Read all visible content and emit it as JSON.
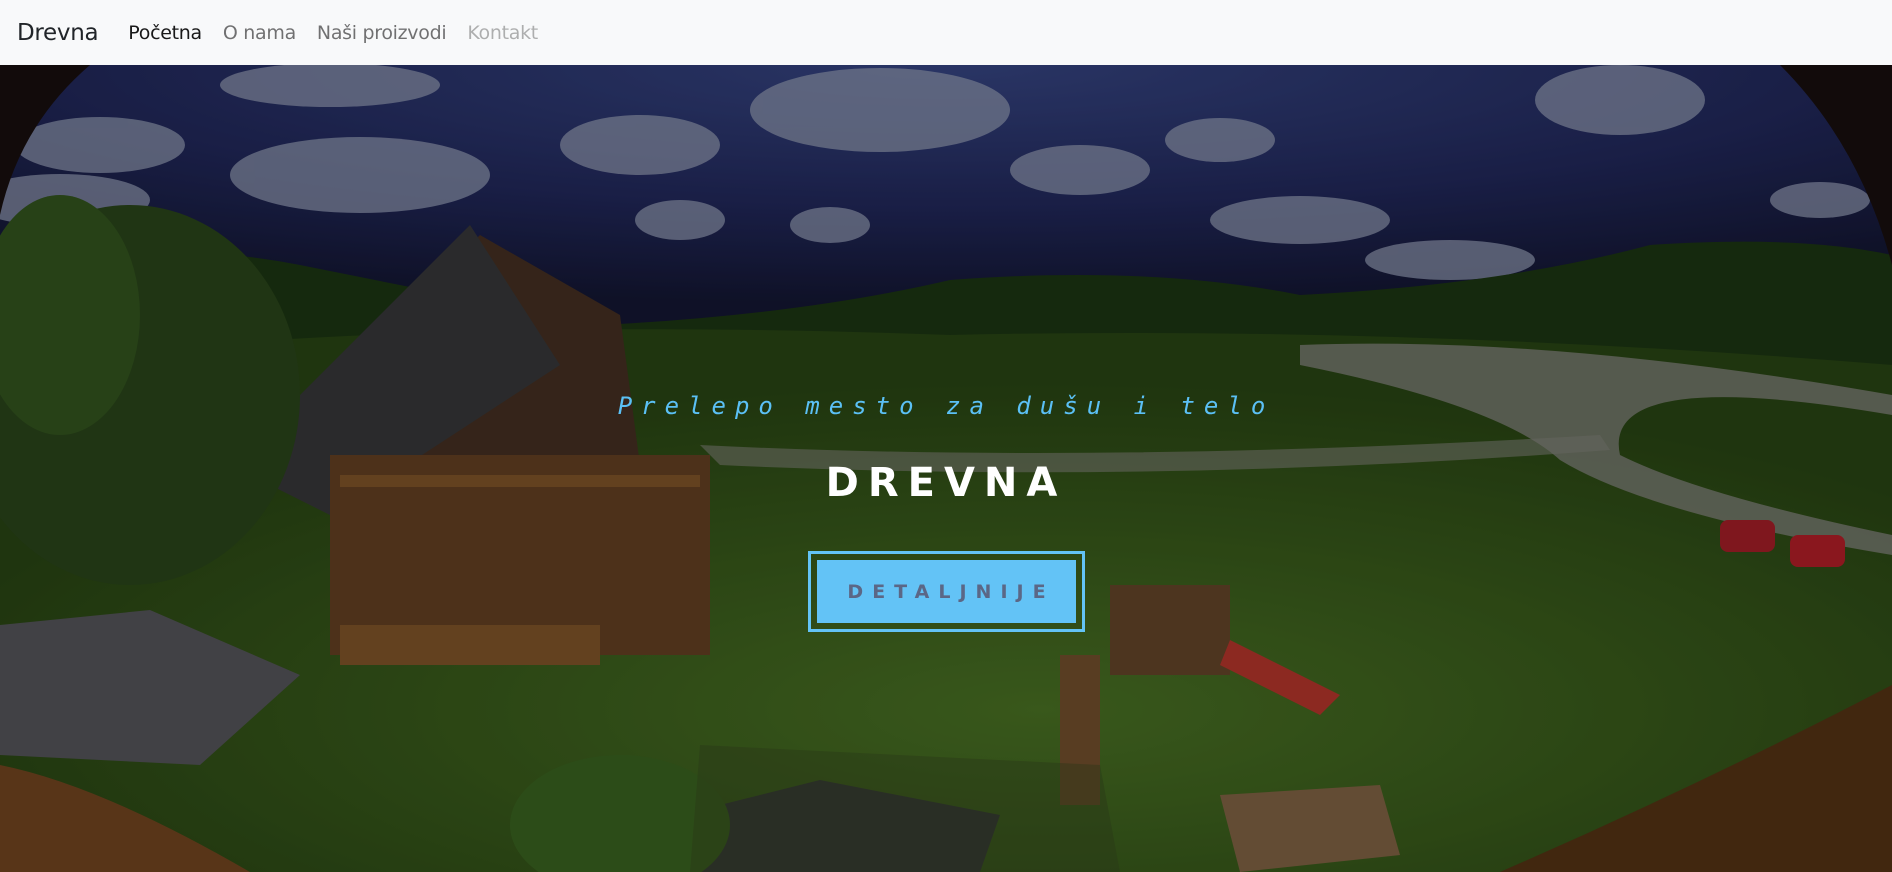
{
  "navbar": {
    "brand": "Drevna",
    "links": [
      {
        "label": "Početna",
        "state": "active"
      },
      {
        "label": "O nama",
        "state": "default"
      },
      {
        "label": "Naši proizvodi",
        "state": "default"
      },
      {
        "label": "Kontakt",
        "state": "disabled"
      }
    ]
  },
  "hero": {
    "tagline": "Prelepo mesto za dušu i telo",
    "title": "DREVNA",
    "button_label": "DETALJNIJE",
    "accent_color": "#63c3f6"
  }
}
